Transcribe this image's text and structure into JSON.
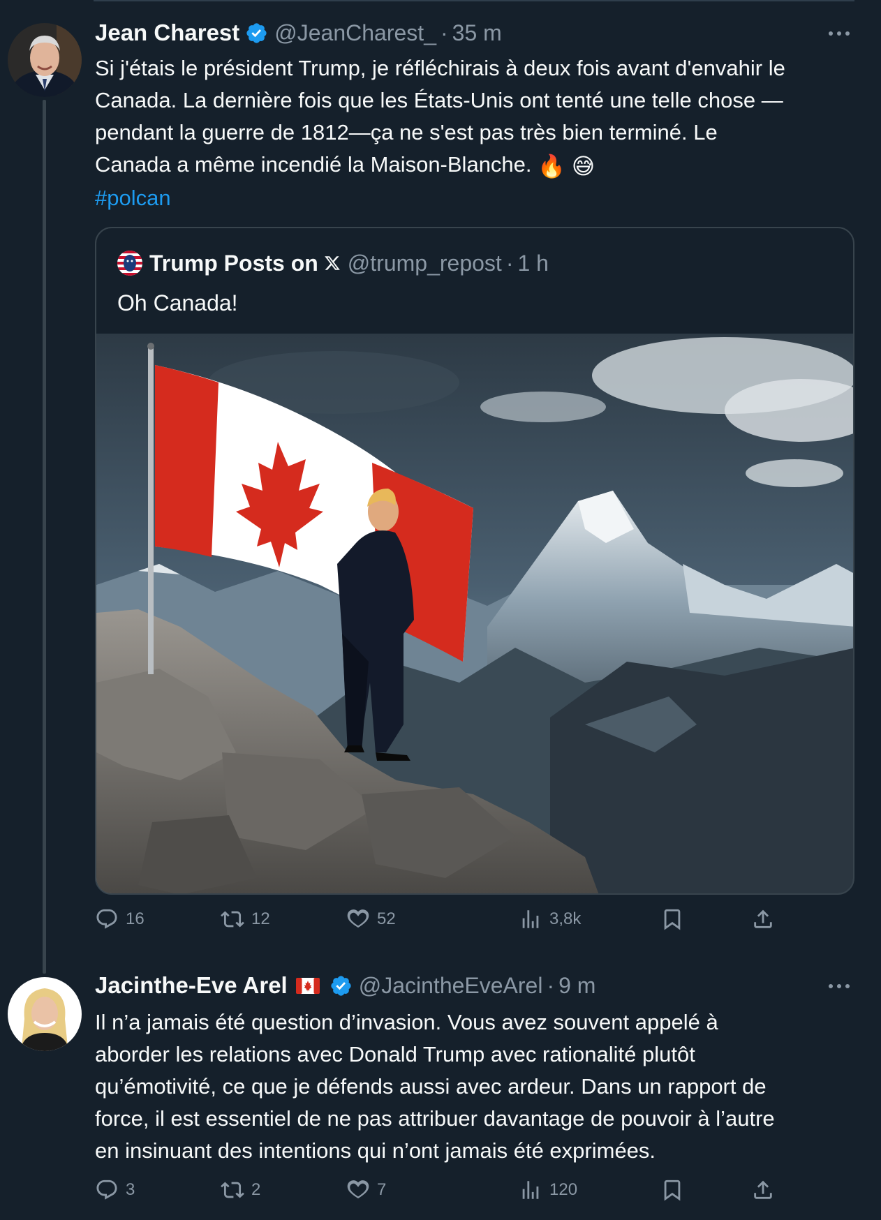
{
  "tweet1": {
    "author_name": "Jean Charest",
    "handle": "@JeanCharest_",
    "separator": "·",
    "time": "35 m",
    "text_lines": [
      "Si j'étais le président Trump, je réfléchirais à deux fois avant d'envahir le",
      "Canada. La dernière fois que les États-Unis ont tenté une telle chose —",
      "pendant la guerre de 1812—ça ne s'est pas très bien terminé. Le",
      "Canada a même incendié la Maison-Blanche."
    ],
    "emojis": "🔥 😅",
    "hashtag": "#polcan",
    "quote": {
      "author_name": "Trump Posts on",
      "handle": "@trump_repost",
      "separator": "·",
      "time": "1 h",
      "text": "Oh Canada!"
    },
    "stats": {
      "replies": "16",
      "retweets": "12",
      "likes": "52",
      "views": "3,8k"
    }
  },
  "tweet2": {
    "author_name": "Jacinthe-Eve Arel",
    "handle": "@JacintheEveArel",
    "separator": "·",
    "time": "9 m",
    "text_lines": [
      "Il n’a jamais été question d’invasion. Vous avez souvent appelé à",
      "aborder les relations avec Donald Trump avec rationalité plutôt",
      "qu’émotivité, ce que je défends aussi avec ardeur. Dans un rapport de",
      "force, il est essentiel de ne pas attribuer davantage de pouvoir à l’autre",
      "en insinuant des intentions qui n’ont jamais été exprimées."
    ],
    "stats": {
      "replies": "3",
      "retweets": "2",
      "likes": "7",
      "views": "120"
    }
  },
  "colors": {
    "background": "#15202b",
    "text": "#f7f9f9",
    "secondary": "#8b98a5",
    "accent": "#1d9bf0",
    "border": "#38444d"
  }
}
